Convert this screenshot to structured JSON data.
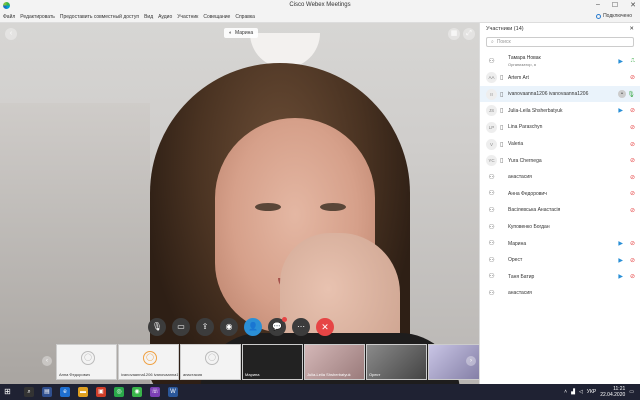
{
  "window": {
    "title": "Cisco Webex Meetings"
  },
  "menu": [
    "Файл",
    "Редактировать",
    "Предоставить совместный доступ",
    "Вид",
    "Аудио",
    "Участник",
    "Совещание",
    "Справка"
  ],
  "connection": {
    "label": "Подключено"
  },
  "speaker": {
    "name": "Марина"
  },
  "controls": [
    {
      "name": "mute-button",
      "icon": "mic-off-icon",
      "glyph": "🎙"
    },
    {
      "name": "video-button",
      "icon": "camera-icon",
      "glyph": "▭"
    },
    {
      "name": "share-button",
      "icon": "share-icon",
      "glyph": "⇪"
    },
    {
      "name": "record-button",
      "icon": "record-icon",
      "glyph": "◉"
    },
    {
      "name": "participants-button",
      "icon": "person-icon",
      "glyph": "👤"
    },
    {
      "name": "chat-button",
      "icon": "chat-icon",
      "glyph": "💬"
    },
    {
      "name": "more-button",
      "icon": "more-icon",
      "glyph": "⋯"
    },
    {
      "name": "leave-button",
      "icon": "close-icon",
      "glyph": "✕"
    }
  ],
  "thumbnails": [
    {
      "name": "Анна Федорович",
      "type": "avatar"
    },
    {
      "name": "ivanovaanna1206 ivanovaanna1206",
      "type": "avatar-orange"
    },
    {
      "name": "анастасия",
      "type": "avatar"
    },
    {
      "name": "Марина",
      "type": "dark"
    },
    {
      "name": "Julia-Leila Shsherbatyuk",
      "type": "video1"
    },
    {
      "name": "Орест",
      "type": "video2"
    },
    {
      "name": "",
      "type": "video3"
    }
  ],
  "panel": {
    "title": "Участники (14)",
    "search_placeholder": "Поиск",
    "participants": [
      {
        "initials": "",
        "name": "Тамара Новак",
        "role": "Организатор, я",
        "cam": true,
        "mic": "on"
      },
      {
        "initials": "AA",
        "name": "Artem Art",
        "cam": false,
        "mic": "off"
      },
      {
        "initials": "II",
        "name": "ivanovaanna1206 ivanovaanna1206",
        "cam": false,
        "mic": "chat",
        "selected": true
      },
      {
        "initials": "JS",
        "name": "Julia-Leila Shsherbatyuk",
        "cam": true,
        "mic": "off"
      },
      {
        "initials": "LP",
        "name": "Lina Paraschyn",
        "cam": false,
        "mic": "off"
      },
      {
        "initials": "V",
        "name": "Valeria",
        "cam": false,
        "mic": "off"
      },
      {
        "initials": "YC",
        "name": "Yura Chernega",
        "cam": false,
        "mic": "off"
      },
      {
        "initials": "",
        "name": "анастасия",
        "cam": false,
        "mic": "off"
      },
      {
        "initials": "",
        "name": "Анна Федорович",
        "cam": false,
        "mic": "off"
      },
      {
        "initials": "",
        "name": "Васілевська Анастасія",
        "cam": false,
        "mic": "off"
      },
      {
        "initials": "",
        "name": "Куповенко Богдан",
        "cam": false,
        "mic": "none"
      },
      {
        "initials": "",
        "name": "Марина",
        "cam": true,
        "mic": "off"
      },
      {
        "initials": "",
        "name": "Орест",
        "cam": true,
        "mic": "off"
      },
      {
        "initials": "",
        "name": "Таня Батир",
        "cam": true,
        "mic": "off"
      },
      {
        "initials": "",
        "name": "анастасия",
        "cam": false,
        "mic": "none"
      }
    ]
  },
  "taskbar": {
    "lang": "УКР",
    "time": "11:21",
    "date": "22.04.2020"
  }
}
